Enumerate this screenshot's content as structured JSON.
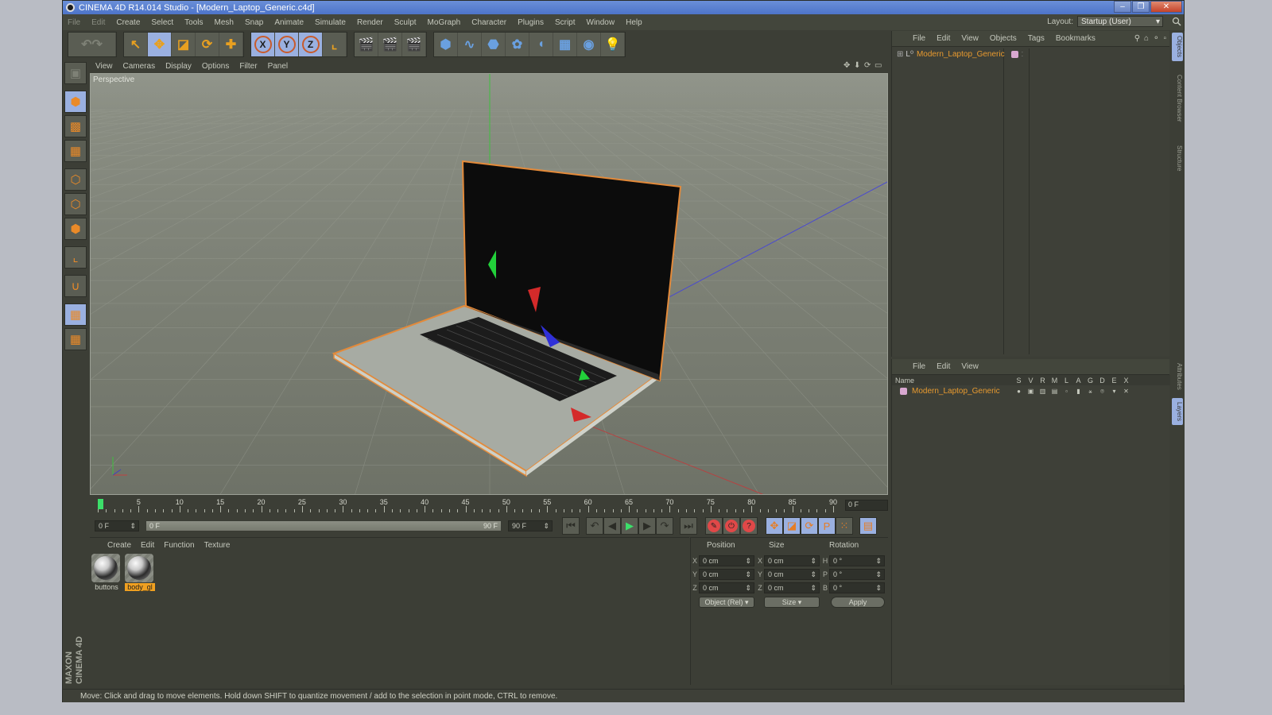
{
  "window": {
    "title": "CINEMA 4D R14.014 Studio - [Modern_Laptop_Generic.c4d]",
    "buttons": {
      "minimize": "–",
      "restore": "❐",
      "close": "✕"
    }
  },
  "menubar": {
    "items": [
      "File",
      "Edit",
      "Create",
      "Select",
      "Tools",
      "Mesh",
      "Snap",
      "Animate",
      "Simulate",
      "Render",
      "Sculpt",
      "MoGraph",
      "Character",
      "Plugins",
      "Script",
      "Window",
      "Help"
    ],
    "layout_label": "Layout:",
    "layout_value": "Startup (User)"
  },
  "toolbar": {
    "groups": [
      [
        {
          "icon": "undo-redo-icon",
          "glyph": "↶↷",
          "active": false
        }
      ],
      [
        {
          "icon": "live-selection-icon",
          "glyph": "↖",
          "active": false
        },
        {
          "icon": "move-icon",
          "glyph": "✥",
          "active": true
        },
        {
          "icon": "scale-icon",
          "glyph": "◪",
          "active": false
        },
        {
          "icon": "rotate-icon",
          "glyph": "⟳",
          "active": false
        },
        {
          "icon": "recent-tool-icon",
          "glyph": "✚",
          "active": false
        }
      ],
      [
        {
          "icon": "x-axis-icon",
          "glyph": "X",
          "active": true
        },
        {
          "icon": "y-axis-icon",
          "glyph": "Y",
          "active": true
        },
        {
          "icon": "z-axis-icon",
          "glyph": "Z",
          "active": true
        },
        {
          "icon": "coordinate-system-icon",
          "glyph": "⌞",
          "active": false
        }
      ],
      [
        {
          "icon": "render-view-icon",
          "glyph": "🎬",
          "active": false
        },
        {
          "icon": "render-picture-viewer-icon",
          "glyph": "🎬",
          "active": false
        },
        {
          "icon": "render-settings-icon",
          "glyph": "🎬",
          "active": false
        }
      ],
      [
        {
          "icon": "cube-icon",
          "glyph": "⬢",
          "active": false
        },
        {
          "icon": "spline-icon",
          "glyph": "∿",
          "active": false
        },
        {
          "icon": "nurbs-icon",
          "glyph": "⬣",
          "active": false
        },
        {
          "icon": "mograph-cloner-icon",
          "glyph": "✿",
          "active": false
        },
        {
          "icon": "deformer-icon",
          "glyph": "◖",
          "active": false
        },
        {
          "icon": "floor-icon",
          "glyph": "▦",
          "active": false
        },
        {
          "icon": "camera-icon",
          "glyph": "◉",
          "active": false
        },
        {
          "icon": "light-icon",
          "glyph": "💡",
          "active": false
        }
      ]
    ]
  },
  "left_tools": [
    {
      "icon": "model-mode-icon",
      "glyph": "▣",
      "active": false
    },
    {
      "icon": "object-mode-icon",
      "glyph": "⬢",
      "active": true
    },
    {
      "icon": "texture-mode-icon",
      "glyph": "▩",
      "active": false
    },
    {
      "icon": "workplane-mode-icon",
      "glyph": "▦",
      "active": false
    },
    {
      "icon": "points-mode-icon",
      "glyph": "⬡",
      "active": false
    },
    {
      "icon": "edges-mode-icon",
      "glyph": "⬡",
      "active": false
    },
    {
      "icon": "polygons-mode-icon",
      "glyph": "⬢",
      "active": false
    },
    {
      "icon": "axis-mode-icon",
      "glyph": "⌞",
      "active": false
    },
    {
      "icon": "magnet-icon",
      "glyph": "∪",
      "active": false
    },
    {
      "icon": "lock-workplane-icon",
      "glyph": "▦",
      "active": true
    },
    {
      "icon": "planar-workplane-icon",
      "glyph": "▦",
      "active": false
    }
  ],
  "viewport": {
    "menu": [
      "View",
      "Cameras",
      "Display",
      "Options",
      "Filter",
      "Panel"
    ],
    "label": "Perspective",
    "nav_icons": [
      "move-view-icon",
      "dolly-view-icon",
      "rotate-view-icon",
      "maximize-view-icon"
    ]
  },
  "timeline": {
    "ticks": [
      0,
      5,
      10,
      15,
      20,
      25,
      30,
      35,
      40,
      45,
      50,
      55,
      60,
      65,
      70,
      75,
      80,
      85,
      90
    ],
    "current_frame_value": 0,
    "current_frame": "0 F",
    "start_field": "0 F",
    "range_start": "0 F",
    "range_end": "90 F",
    "end_field": "90 F"
  },
  "transport": [
    {
      "icon": "go-to-start-icon",
      "glyph": "⏮"
    },
    {
      "icon": "go-to-previous-keyframe-icon",
      "glyph": "↶"
    },
    {
      "icon": "go-to-previous-frame-icon",
      "glyph": "◀"
    },
    {
      "icon": "play-forwards-icon",
      "glyph": "▶"
    },
    {
      "icon": "go-to-next-frame-icon",
      "glyph": "▶"
    },
    {
      "icon": "go-to-next-keyframe-icon",
      "glyph": "↷"
    },
    {
      "icon": "go-to-end-icon",
      "glyph": "⏭"
    }
  ],
  "record": [
    {
      "icon": "record-active-objects-icon",
      "glyph": "✎"
    },
    {
      "icon": "autokeying-icon",
      "glyph": "⏻"
    },
    {
      "icon": "keyframe-selection-icon",
      "glyph": "?"
    }
  ],
  "key_filters": [
    {
      "icon": "position-key-icon",
      "glyph": "✥"
    },
    {
      "icon": "scale-key-icon",
      "glyph": "◪"
    },
    {
      "icon": "rotation-key-icon",
      "glyph": "⟳"
    },
    {
      "icon": "parameter-key-icon",
      "glyph": "P"
    },
    {
      "icon": "point-level-key-icon",
      "glyph": "⁙"
    }
  ],
  "timeline_toggle_icon": "timeline-icon",
  "materials": {
    "menu": [
      "Create",
      "Edit",
      "Function",
      "Texture"
    ],
    "items": [
      {
        "name": "buttons",
        "selected": false
      },
      {
        "name": "body_gl",
        "selected": true
      }
    ]
  },
  "coordinates": {
    "headers": [
      "Position",
      "Size",
      "Rotation"
    ],
    "rows": [
      {
        "pos_axis": "X",
        "pos": "0 cm",
        "size_axis": "X",
        "size": "0 cm",
        "rot_axis": "H",
        "rot": "0 °"
      },
      {
        "pos_axis": "Y",
        "pos": "0 cm",
        "size_axis": "Y",
        "size": "0 cm",
        "rot_axis": "P",
        "rot": "0 °"
      },
      {
        "pos_axis": "Z",
        "pos": "0 cm",
        "size_axis": "Z",
        "size": "0 cm",
        "rot_axis": "B",
        "rot": "0 °"
      }
    ],
    "mode_select": "Object (Rel)",
    "size_select": "Size",
    "apply_label": "Apply"
  },
  "object_manager": {
    "menu": [
      "File",
      "Edit",
      "View",
      "Objects",
      "Tags",
      "Bookmarks"
    ],
    "objects": [
      {
        "name": "Modern_Laptop_Generic",
        "color": "#d8a8d0"
      }
    ]
  },
  "layer_manager": {
    "menu": [
      "File",
      "Edit",
      "View"
    ],
    "columns_name": "Name",
    "columns": [
      "S",
      "V",
      "R",
      "M",
      "L",
      "A",
      "G",
      "D",
      "E",
      "X"
    ],
    "layers": [
      {
        "name": "Modern_Laptop_Generic",
        "color": "#d8a8d0"
      }
    ]
  },
  "side_tabs": [
    {
      "label": "Objects",
      "active": true
    },
    {
      "label": "Content Browser",
      "active": false
    },
    {
      "label": "Structure",
      "active": false
    },
    {
      "label": "Attributes",
      "active": false
    },
    {
      "label": "Layers",
      "active": true
    }
  ],
  "branding": "MAXON CINEMA 4D",
  "status": "Move: Click and drag to move elements. Hold down SHIFT to quantize movement / add to the selection in point mode, CTRL to remove.",
  "colors": {
    "accent_orange": "#e89a2f",
    "active_blue": "#9ab0e0",
    "play_green": "#3cdf6a",
    "record_red": "#e04848"
  }
}
